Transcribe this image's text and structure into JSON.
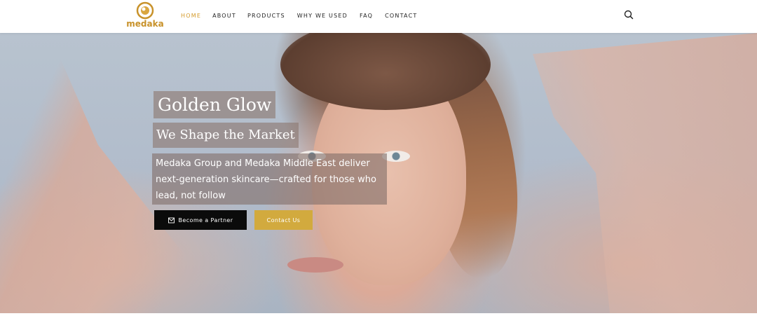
{
  "brand": {
    "logo_text": "medaka",
    "accent_color": "#d49a2a",
    "button_gold": "#d2aa3e"
  },
  "nav": {
    "items": [
      {
        "label": "HOME",
        "active": true
      },
      {
        "label": "ABOUT",
        "active": false
      },
      {
        "label": "PRODUCTS",
        "active": false
      },
      {
        "label": "WHY WE USED",
        "active": false
      },
      {
        "label": "FAQ",
        "active": false
      },
      {
        "label": "CONTACT",
        "active": false
      }
    ],
    "search_icon": "search-icon"
  },
  "hero": {
    "title": "Golden Glow",
    "subtitle": "We Shape the Market",
    "description": "Medaka Group and Medaka Middle East deliver next-generation skincare—crafted for those who lead, not follow",
    "primary_button": {
      "label": "Become a Partner",
      "icon": "mail-icon"
    },
    "secondary_button": {
      "label": "Contact Us"
    }
  }
}
